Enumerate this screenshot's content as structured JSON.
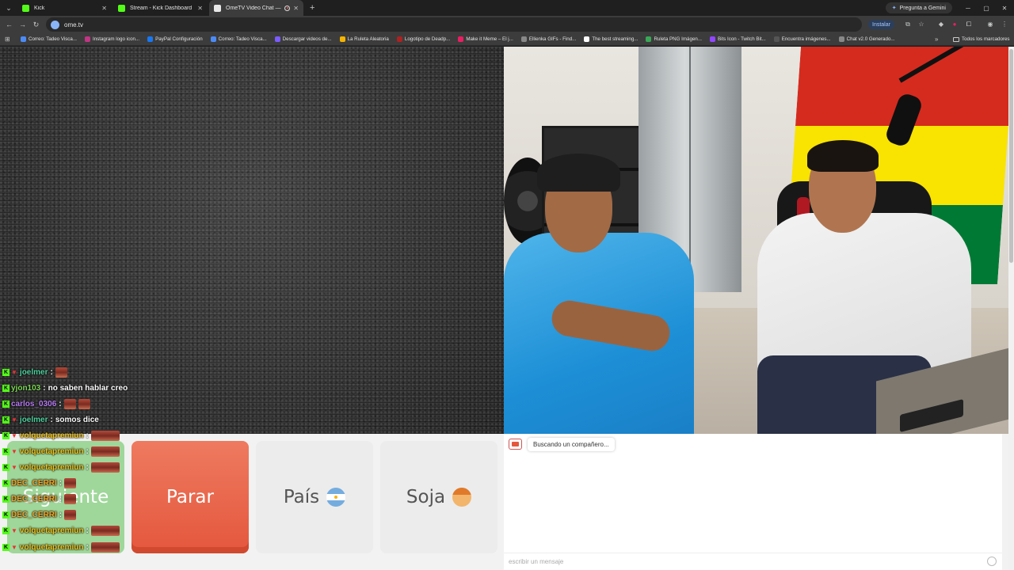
{
  "browser": {
    "tabs": [
      {
        "title": "Kick",
        "favicon": "kick-icon"
      },
      {
        "title": "Stream - Kick Dashboard",
        "favicon": "kick-icon"
      },
      {
        "title": "OmeTV Video Chat — Alte",
        "favicon": "ometv-icon",
        "active": true
      }
    ],
    "gemini_label": "Pregunta a Gemini",
    "url": "ome.tv",
    "install_label": "Instalar",
    "bookmarks": [
      {
        "label": "Correo: Tadeo Visca...",
        "color": "#4c8bf5"
      },
      {
        "label": "Instagram logo icon...",
        "color": "#c13584"
      },
      {
        "label": "PayPal Configuración",
        "color": "#1877f2"
      },
      {
        "label": "Correo: Tadeo Visca...",
        "color": "#4c8bf5"
      },
      {
        "label": "Descargar videos de...",
        "color": "#7b5cff"
      },
      {
        "label": "La Ruleta Aleatoria",
        "color": "#f4b400"
      },
      {
        "label": "Logotipo de Deadp...",
        "color": "#aa2222"
      },
      {
        "label": "Make it Meme – El j...",
        "color": "#e91e63"
      },
      {
        "label": "Ellienka GIFs - Find...",
        "color": "#888888"
      },
      {
        "label": "The best streaming...",
        "color": "#ffffff"
      },
      {
        "label": "Ruleta PNG Imágen...",
        "color": "#3aa757"
      },
      {
        "label": "Bits Icon - Twitch Bit...",
        "color": "#9146ff"
      },
      {
        "label": "Encuentra imágenes...",
        "color": "#555555"
      },
      {
        "label": "Chat v2.0 Generado...",
        "color": "#888888"
      }
    ],
    "all_bookmarks_label": "Todos los marcadores"
  },
  "kick_chat": [
    {
      "user": "joelmer",
      "color": "#4fd1a0",
      "badges": [
        "kick",
        "vip"
      ],
      "text": "",
      "emotes": [
        "small"
      ]
    },
    {
      "user": "yjon103",
      "color": "#7ed957",
      "badges": [
        "kick"
      ],
      "text": "no saben hablar creo",
      "emotes": []
    },
    {
      "user": "carlos_0306",
      "color": "#b77cf2",
      "badges": [
        "kick"
      ],
      "text": "",
      "emotes": [
        "small",
        "small"
      ]
    },
    {
      "user": "joelmer",
      "color": "#4fd1a0",
      "badges": [
        "kick",
        "vip"
      ],
      "text": "somos dice",
      "emotes": []
    },
    {
      "user": "volquetapremiun",
      "color": "#f0c419",
      "badges": [
        "kick",
        "vip"
      ],
      "text": "",
      "emotes": [
        "wide"
      ]
    },
    {
      "user": "volquetapremiun",
      "color": "#f0c419",
      "badges": [
        "kick",
        "vip"
      ],
      "text": "",
      "emotes": [
        "wide"
      ]
    },
    {
      "user": "volquetapremiun",
      "color": "#f0c419",
      "badges": [
        "kick",
        "vip"
      ],
      "text": "",
      "emotes": [
        "wide"
      ]
    },
    {
      "user": "DEC_CERRI",
      "color": "#f5a623",
      "badges": [
        "kick"
      ],
      "text": "",
      "emotes": [
        "small"
      ]
    },
    {
      "user": "DEC_CERRI",
      "color": "#f5a623",
      "badges": [
        "kick"
      ],
      "text": "",
      "emotes": [
        "small"
      ]
    },
    {
      "user": "DEC_CERRI",
      "color": "#f5a623",
      "badges": [
        "kick"
      ],
      "text": "",
      "emotes": [
        "small"
      ]
    },
    {
      "user": "volquetapremiun",
      "color": "#f0c419",
      "badges": [
        "kick",
        "vip"
      ],
      "text": "",
      "emotes": [
        "wide"
      ]
    },
    {
      "user": "volquetapremiun",
      "color": "#f0c419",
      "badges": [
        "kick",
        "vip"
      ],
      "text": "",
      "emotes": [
        "wide"
      ]
    }
  ],
  "controls": {
    "next_label": "Siguiente",
    "stop_label": "Parar",
    "country_label": "País",
    "gender_label": "Soja"
  },
  "ome_chat": {
    "status_message": "Buscando un compañero...",
    "input_placeholder": "escribir un mensaje"
  },
  "colors": {
    "stop_button": "#e4573d",
    "next_button": "#9fd79a",
    "kick_green": "#53fc18"
  }
}
